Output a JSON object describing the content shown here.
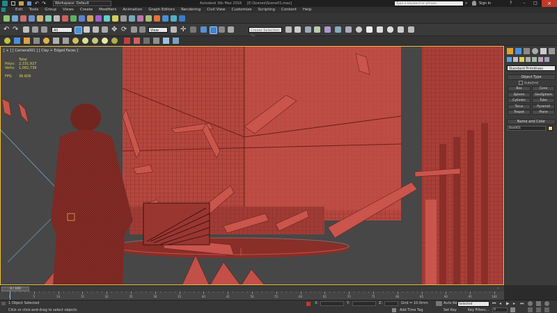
{
  "titlebar": {
    "workspace_label": "Workspace: Default",
    "app_title": "Autodesk 3ds Max 2016",
    "file_name": "[E:\\Scenes\\Scene01.max]",
    "search_placeholder": "Type a keyword or phrase",
    "sign_in": "Sign In"
  },
  "menu": [
    "Edit",
    "Tools",
    "Group",
    "Views",
    "Create",
    "Modifiers",
    "Animation",
    "Graph Editors",
    "Rendering",
    "Civil View",
    "Customize",
    "Scripting",
    "Content",
    "Help"
  ],
  "toolbar": {
    "filter_dropdown": "All",
    "view_dropdown": "View",
    "selection_set_placeholder": "Create Selection Se"
  },
  "viewport": {
    "label": "[ + ] [ Camera001 ] [ Clay + Edged Faces ]",
    "stats": {
      "total_label": "Total",
      "polys_label": "Polys:",
      "polys_value": "2,331,927",
      "verts_label": "Verts:",
      "verts_value": "1,082,739",
      "fps_label": "FPS:",
      "fps_value": "36.606"
    }
  },
  "command_panel": {
    "category_dropdown": "Standard Primitives",
    "object_type_title": "Object Type",
    "autogrid_label": "AutoGrid",
    "primitives": [
      "Box",
      "Cone",
      "Sphere",
      "GeoSphere",
      "Cylinder",
      "Tube",
      "Torus",
      "Pyramid",
      "Teapot",
      "Plane"
    ],
    "name_color_title": "Name and Color",
    "object_name": "Box001",
    "object_color": "#e8d17a"
  },
  "timeline": {
    "frame_counter": "0 / 100",
    "ticks": [
      "0",
      "5",
      "10",
      "15",
      "20",
      "25",
      "30",
      "35",
      "40",
      "45",
      "50",
      "55",
      "60",
      "65",
      "70",
      "75",
      "80",
      "85",
      "90",
      "95",
      "100"
    ]
  },
  "status": {
    "selection_text": "1 Object Selected",
    "prompt_text": "Click or click-and-drag to select objects",
    "x_label": "X:",
    "y_label": "Y:",
    "z_label": "Z:",
    "grid_text": "Grid = 10.0mm",
    "add_time_tag": "Add Time Tag",
    "auto_key": "Auto Key",
    "set_key": "Set Key",
    "key_mode_value": "Selected",
    "key_filters": "Key Filters...",
    "current_frame": "0"
  },
  "colors": {
    "model_red": "#b5473f",
    "model_dark": "#7a2822",
    "accent_yellow": "#f0c040",
    "stat_yellow": "#e6d34a"
  }
}
